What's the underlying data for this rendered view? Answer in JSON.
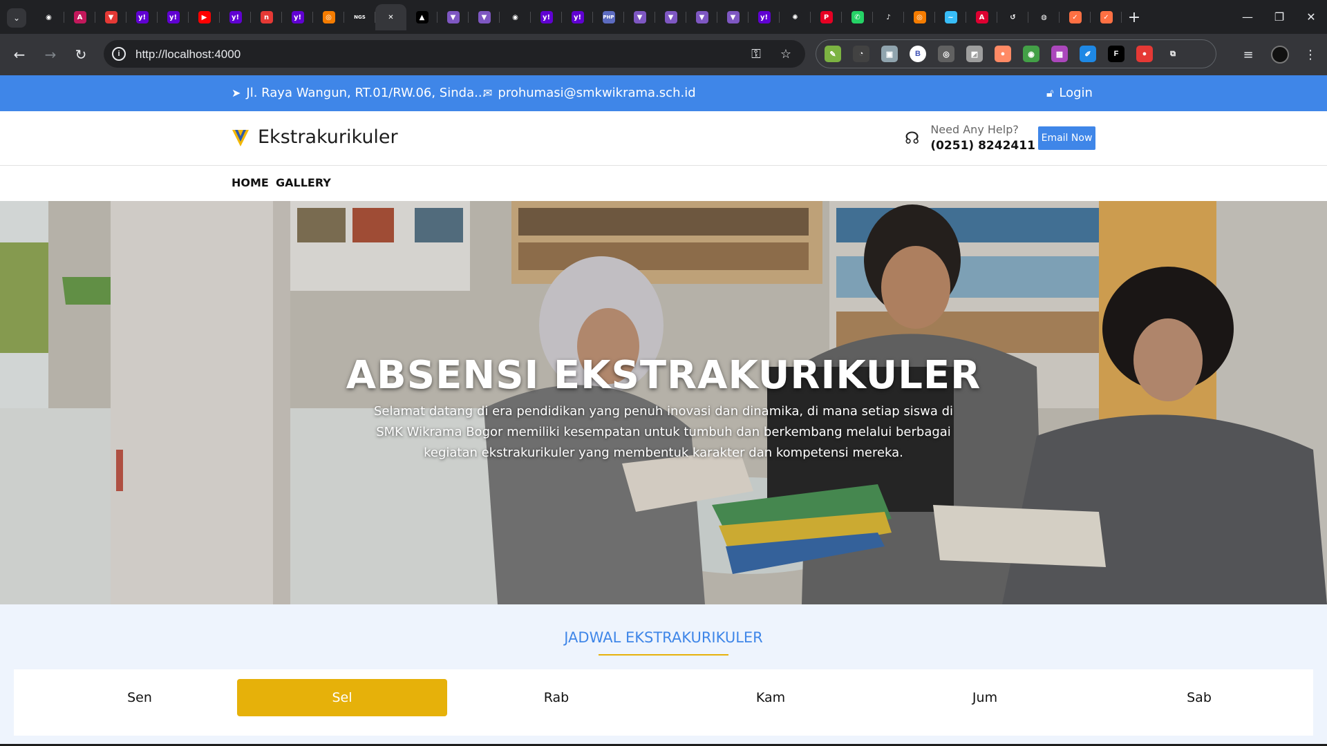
{
  "browser": {
    "tabs": [
      {
        "icon": "github-icon",
        "color": "#202124",
        "glyph": "◉"
      },
      {
        "icon": "arc-icon",
        "color": "#c2185b",
        "glyph": "A"
      },
      {
        "icon": "brave-icon",
        "color": "#e53935",
        "glyph": "▼"
      },
      {
        "icon": "yahoo-icon",
        "color": "#6001d2",
        "glyph": "y!"
      },
      {
        "icon": "yahoo-icon",
        "color": "#6001d2",
        "glyph": "y!"
      },
      {
        "icon": "youtube-icon",
        "color": "#ff0000",
        "glyph": "▶"
      },
      {
        "icon": "yahoo-icon",
        "color": "#6001d2",
        "glyph": "y!"
      },
      {
        "icon": "notion-red-icon",
        "color": "#e53935",
        "glyph": "n"
      },
      {
        "icon": "yahoo-icon",
        "color": "#6001d2",
        "glyph": "y!"
      },
      {
        "icon": "orange-app-icon",
        "color": "#f57c00",
        "glyph": "◎"
      },
      {
        "icon": "ngs-icon",
        "color": "#202124",
        "glyph": "NGS"
      },
      {
        "icon": "close-icon",
        "color": "#35363a",
        "glyph": "✕",
        "active": true
      },
      {
        "icon": "vercel-icon",
        "color": "#000000",
        "glyph": "▲"
      },
      {
        "icon": "vite-icon",
        "color": "#7e57c2",
        "glyph": "▼"
      },
      {
        "icon": "vite-icon",
        "color": "#7e57c2",
        "glyph": "▼"
      },
      {
        "icon": "github-dark-icon",
        "color": "#202124",
        "glyph": "◉"
      },
      {
        "icon": "yahoo-icon",
        "color": "#6001d2",
        "glyph": "y!"
      },
      {
        "icon": "yahoo-icon",
        "color": "#6001d2",
        "glyph": "y!"
      },
      {
        "icon": "php-icon",
        "color": "#5c6bc0",
        "glyph": "PHP"
      },
      {
        "icon": "vite-icon",
        "color": "#7e57c2",
        "glyph": "▼"
      },
      {
        "icon": "vite-icon",
        "color": "#7e57c2",
        "glyph": "▼"
      },
      {
        "icon": "vite-icon",
        "color": "#7e57c2",
        "glyph": "▼"
      },
      {
        "icon": "vite-icon",
        "color": "#7e57c2",
        "glyph": "▼"
      },
      {
        "icon": "yahoo-icon",
        "color": "#6001d2",
        "glyph": "y!"
      },
      {
        "icon": "chatgpt-icon",
        "color": "#202124",
        "glyph": "✺"
      },
      {
        "icon": "pinterest-icon",
        "color": "#e60023",
        "glyph": "P"
      },
      {
        "icon": "whatsapp-icon",
        "color": "#25d366",
        "glyph": "✆"
      },
      {
        "icon": "speaker-icon",
        "color": "#202124",
        "glyph": "♪"
      },
      {
        "icon": "orange-app-icon",
        "color": "#f57c00",
        "glyph": "◎"
      },
      {
        "icon": "tailwind-icon",
        "color": "#38bdf8",
        "glyph": "~"
      },
      {
        "icon": "angular-icon",
        "color": "#dd0031",
        "glyph": "A"
      },
      {
        "icon": "history-icon",
        "color": "#202124",
        "glyph": "↺"
      },
      {
        "icon": "globe-icon",
        "color": "#202124",
        "glyph": "◍"
      },
      {
        "icon": "orange-check-icon",
        "color": "#ff7043",
        "glyph": "✓"
      },
      {
        "icon": "orange-check-icon",
        "color": "#ff7043",
        "glyph": "✓"
      }
    ],
    "new_tab": "+",
    "url": "http://localhost:4000",
    "extensions": [
      {
        "icon": "pencil-ext-icon",
        "color": "#7cb342",
        "glyph": "✎"
      },
      {
        "icon": "speed-ext-icon",
        "color": "#424242",
        "glyph": "◔"
      },
      {
        "icon": "image-ext-icon",
        "color": "#90a4ae",
        "glyph": "▣"
      },
      {
        "icon": "b-ext-icon",
        "color": "#ffffff",
        "glyph": "B"
      },
      {
        "icon": "owl-ext-icon",
        "color": "#616161",
        "glyph": "◎"
      },
      {
        "icon": "grey-ext-icon",
        "color": "#9e9e9e",
        "glyph": "◩"
      },
      {
        "icon": "bottle-ext-icon",
        "color": "#ff8a65",
        "glyph": "●"
      },
      {
        "icon": "eye-ext-icon",
        "color": "#43a047",
        "glyph": "◉"
      },
      {
        "icon": "color-ext-icon",
        "color": "#ab47bc",
        "glyph": "▦"
      },
      {
        "icon": "edit-ext-icon",
        "color": "#1e88e5",
        "glyph": "✐"
      },
      {
        "icon": "fx-ext-icon",
        "color": "#000000",
        "glyph": "F"
      },
      {
        "icon": "chat-ext-icon",
        "color": "#e53935",
        "glyph": "●"
      },
      {
        "icon": "puzzle-icon",
        "color": "#35363a",
        "glyph": "⧉"
      }
    ]
  },
  "topbar": {
    "address": "Jl. Raya Wangun, RT.01/RW.06, Sinda...",
    "email": "prohumasi@smkwikrama.sch.id",
    "login": "Login"
  },
  "header": {
    "brand": "Ekstrakurikuler",
    "help_label": "Need Any Help?",
    "help_phone": "(0251) 8242411",
    "email_button": "Email Now"
  },
  "nav": {
    "home": "HOME",
    "gallery": "GALLERY"
  },
  "hero": {
    "title": "ABSENSI EKSTRAKURIKULER",
    "text": "Selamat datang di era pendidikan yang penuh inovasi dan dinamika, di mana setiap siswa di SMK Wikrama Bogor memiliki kesempatan untuk tumbuh dan berkembang melalui berbagai kegiatan ekstrakurikuler yang membentuk karakter dan kompetensi mereka."
  },
  "schedule": {
    "title": "JADWAL EKSTRAKURIKULER",
    "days": [
      "Sen",
      "Sel",
      "Rab",
      "Kam",
      "Jum",
      "Sab"
    ],
    "active_day": "Sel"
  },
  "colors": {
    "primary": "#3f86e8",
    "accent": "#e6b10a",
    "schedule_bg": "#eef4fd"
  }
}
